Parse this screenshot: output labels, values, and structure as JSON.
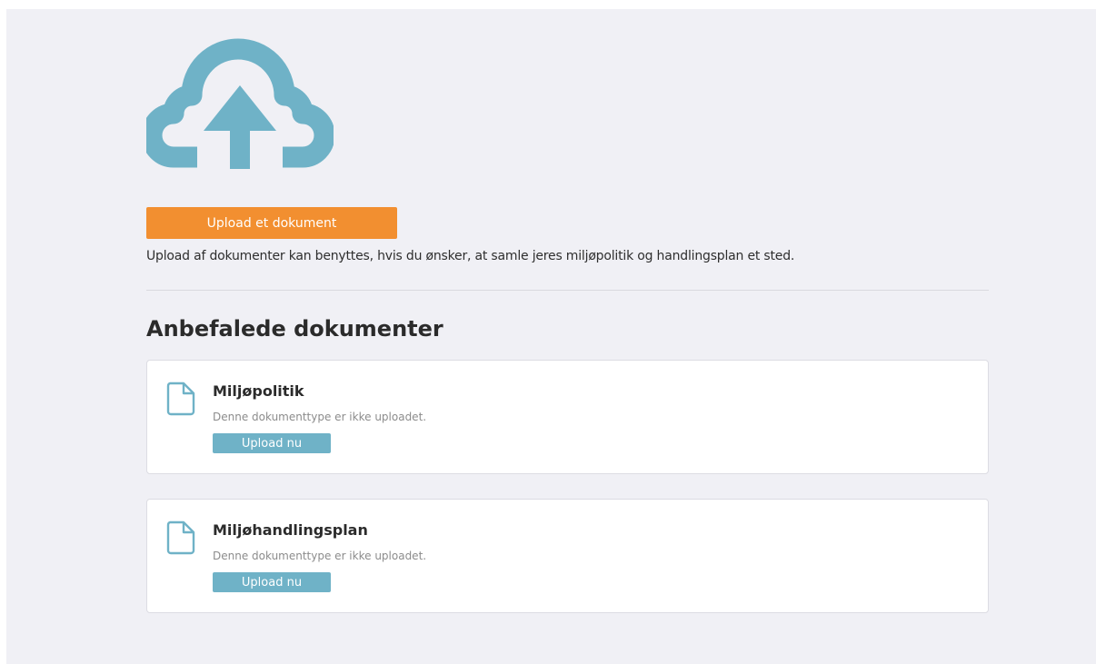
{
  "colors": {
    "accent_orange": "#f28f30",
    "accent_teal": "#6fb2c7",
    "panel_bg": "#f0f0f5"
  },
  "hero": {
    "icon": "cloud-upload-icon"
  },
  "upload": {
    "button_label": "Upload et dokument",
    "description": "Upload af dokumenter kan benyttes, hvis du ønsker, at samle jeres miljøpolitik og handlingsplan et sted."
  },
  "recommended": {
    "title": "Anbefalede dokumenter",
    "documents": [
      {
        "icon": "document-icon",
        "title": "Miljøpolitik",
        "status": "Denne dokumenttype er ikke uploadet.",
        "button_label": "Upload nu"
      },
      {
        "icon": "document-icon",
        "title": "Miljøhandlingsplan",
        "status": "Denne dokumenttype er ikke uploadet.",
        "button_label": "Upload nu"
      }
    ]
  }
}
